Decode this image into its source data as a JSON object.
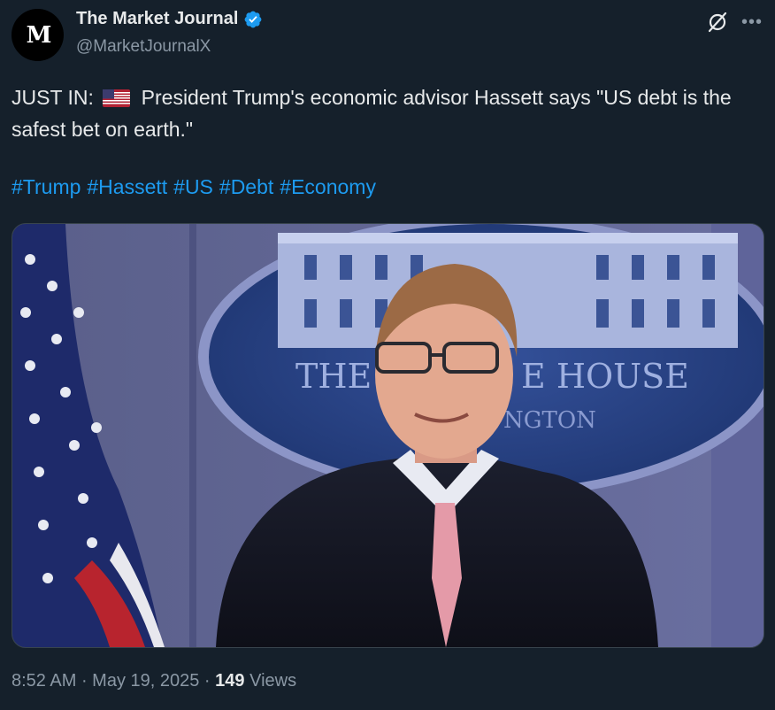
{
  "post": {
    "author_name": "The Market Journal",
    "author_handle": "@MarketJournalX",
    "avatar_letter": "M",
    "text_prefix": "JUST IN:",
    "text_body": "President Trump's economic advisor Hassett says \"US debt is the safest bet on earth.\"",
    "hashtags": [
      "#Trump",
      "#Hassett",
      "#US",
      "#Debt",
      "#Economy"
    ],
    "time": "8:52 AM",
    "date": "May 19, 2025",
    "views_count": "149",
    "views_label": "Views"
  },
  "image": {
    "sign_text_left": "THE",
    "sign_text_right": "E HOUSE",
    "sign_subtext": "NGTON"
  },
  "icons": {
    "verified": "verified-badge-icon",
    "grok": "grok-icon",
    "more": "more-icon",
    "flag": "us-flag-icon"
  },
  "colors": {
    "background": "#15202b",
    "link": "#1d9bf0",
    "secondary_text": "#8b98a5",
    "verified": "#1d9bf0"
  }
}
